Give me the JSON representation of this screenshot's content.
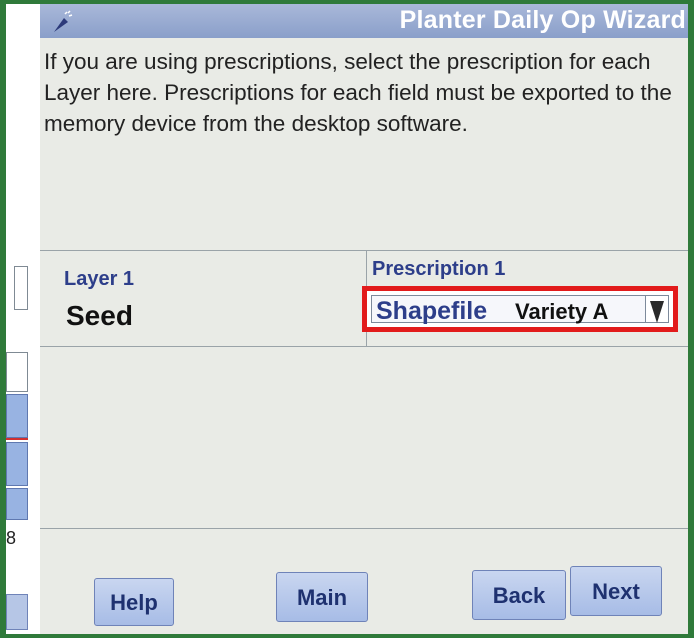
{
  "window": {
    "title": "Planter Daily Op Wizard"
  },
  "instructions": "If you are using prescriptions, select the prescription for each Layer here. Prescriptions for each field must be exported to the memory device from the desktop software.",
  "layer": {
    "label": "Layer 1",
    "value": "Seed"
  },
  "prescription": {
    "label": "Prescription 1",
    "source": "Shapefile",
    "selected": "Variety A"
  },
  "side_panel": {
    "number": "8"
  },
  "buttons": {
    "help": "Help",
    "main": "Main",
    "back": "Back",
    "next": "Next"
  },
  "colors": {
    "title_bar": "#8a9fca",
    "label_text": "#2d3e8a",
    "highlight_border": "#e21b1b",
    "button": "#a7bce6",
    "bezel": "#2f7a3a"
  },
  "icons": {
    "wizard": "wizard-wand-icon",
    "dropdown": "dropdown-arrow-icon"
  }
}
